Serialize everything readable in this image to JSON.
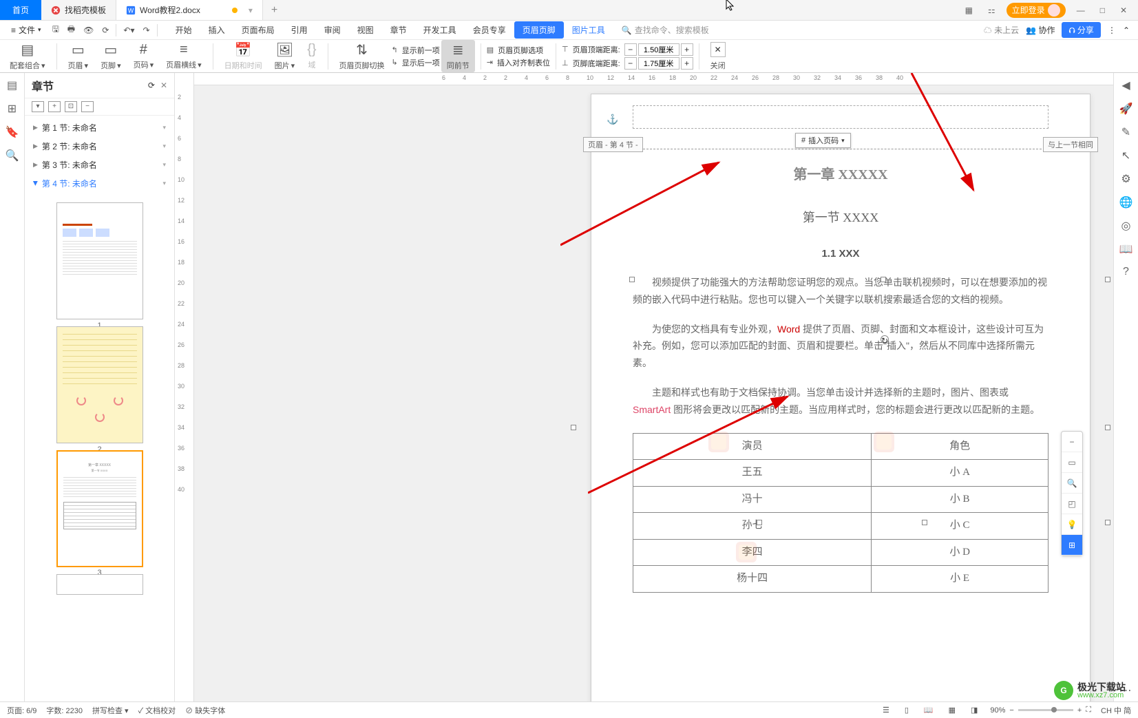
{
  "topTabs": {
    "home": "首页",
    "tab1": "找稻壳模板",
    "tab2": "Word教程2.docx",
    "login": "立即登录"
  },
  "menu": {
    "file": "文件",
    "items": [
      "开始",
      "插入",
      "页面布局",
      "引用",
      "审阅",
      "视图",
      "章节",
      "开发工具",
      "会员专享"
    ],
    "active": "页眉页脚",
    "sub": "图片工具",
    "searchPlaceholder": "查找命令、搜索模板",
    "cloud": "未上云",
    "collab": "协作",
    "share": "分享"
  },
  "ribbon": {
    "combo": "配套组合",
    "header": "页眉",
    "footer": "页脚",
    "pagenum": "页码",
    "hline": "页眉横线",
    "datetime": "日期和时间",
    "picture": "图片",
    "field": "域",
    "switch": "页眉页脚切换",
    "prev": "显示前一项",
    "next": "显示后一项",
    "sameSection": "同前节",
    "hfOptions": "页眉页脚选项",
    "insertAlign": "插入对齐制表位",
    "headerTop": "页眉顶端距离:",
    "footerBottom": "页脚底端距离:",
    "headerTopVal": "1.50厘米",
    "footerBottomVal": "1.75厘米",
    "close": "关闭"
  },
  "nav": {
    "title": "章节",
    "sections": [
      "第 1 节: 未命名",
      "第 2 节: 未命名",
      "第 3 节: 未命名",
      "第 4 节: 未命名"
    ],
    "thumbNums": [
      "1",
      "2",
      "3"
    ]
  },
  "rulerH": [
    "6",
    "4",
    "2",
    "2",
    "4",
    "6",
    "8",
    "10",
    "12",
    "14",
    "16",
    "18",
    "20",
    "22",
    "24",
    "26",
    "28",
    "30",
    "32",
    "34",
    "36",
    "38",
    "40"
  ],
  "rulerV": [
    "2",
    "4",
    "6",
    "8",
    "10",
    "12",
    "14",
    "16",
    "18",
    "20",
    "22",
    "24",
    "26",
    "28",
    "30",
    "32",
    "34",
    "36",
    "38",
    "40"
  ],
  "page": {
    "headerLabel": "页眉 - 第 4 节 -",
    "insertPageNum": "插入页码",
    "sameAsPrev": "与上一节相同",
    "h1": "第一章  XXXXX",
    "h2": "第一节  XXXX",
    "h3": "1.1 XXX",
    "p1a": "视频提供了功能强大的方法帮助您证明您的观点。当您单击联机视频时，可以在想要添加的视频的嵌入代码中进行粘贴。您也可以键入一个关键字以联机搜索最适合您的文档的视频。",
    "p2a": "为使您的文档具有专业外观，",
    "p2word": "Word",
    "p2b": " 提供了页眉、页脚、封面和文本框设计，这些设计可互为补充。例如，您可以添加匹配的封面、页眉和提要栏。单击\"插入\"，然后从不同库中选择所需元素。",
    "p3a": "主题和样式也有助于文档保持协调。当您单击设计并选择新的主题时，图片、图表或 ",
    "p3sa": "SmartArt",
    "p3b": " 图形将会更改以匹配新的主题。当应用样式时，您的标题会进行更改以匹配新的主题。",
    "table": {
      "headers": [
        "演员",
        "角色"
      ],
      "rows": [
        [
          "王五",
          "小 A"
        ],
        [
          "冯十",
          "小 B"
        ],
        [
          "孙七",
          "小 C"
        ],
        [
          "李四",
          "小 D"
        ],
        [
          "杨十四",
          "小 E"
        ]
      ]
    }
  },
  "status": {
    "page": "页面: 6/9",
    "words": "字数: 2230",
    "spell": "拼写检查",
    "proof": "文档校对",
    "missingFont": "缺失字体",
    "ime": "CH 中 简",
    "zoom": "90%"
  },
  "watermark": {
    "name": "极光下载站",
    "url": "www.xz7.com"
  }
}
